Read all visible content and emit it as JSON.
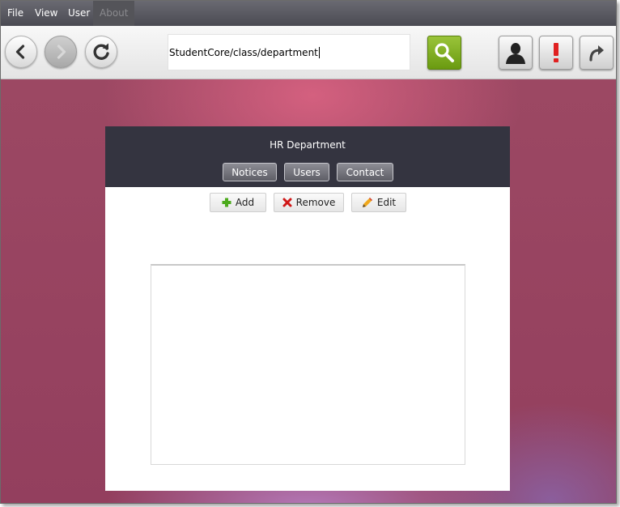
{
  "menu": {
    "items": [
      {
        "label": "File",
        "enabled": true
      },
      {
        "label": "View",
        "enabled": true
      },
      {
        "label": "User",
        "enabled": true
      },
      {
        "label": "About",
        "enabled": false
      }
    ]
  },
  "toolbar": {
    "address_value": "StudentCore/class/department",
    "back_icon": "chevron-left-icon",
    "forward_icon": "chevron-right-icon",
    "refresh_icon": "refresh-icon",
    "search_icon": "magnifier-icon",
    "user_icon": "user-silhouette-icon",
    "alert_icon": "exclamation-icon",
    "logout_icon": "curved-arrow-icon"
  },
  "panel": {
    "title": "HR Department",
    "tabs": [
      {
        "label": "Notices"
      },
      {
        "label": "Users"
      },
      {
        "label": "Contact"
      }
    ],
    "actions": {
      "add_label": "Add",
      "remove_label": "Remove",
      "edit_label": "Edit"
    }
  },
  "colors": {
    "menubar": "#55555d",
    "panel_header": "#343440",
    "search_button": "#7fae22",
    "background_accent": "#9c4863",
    "alert_red": "#e02020"
  }
}
